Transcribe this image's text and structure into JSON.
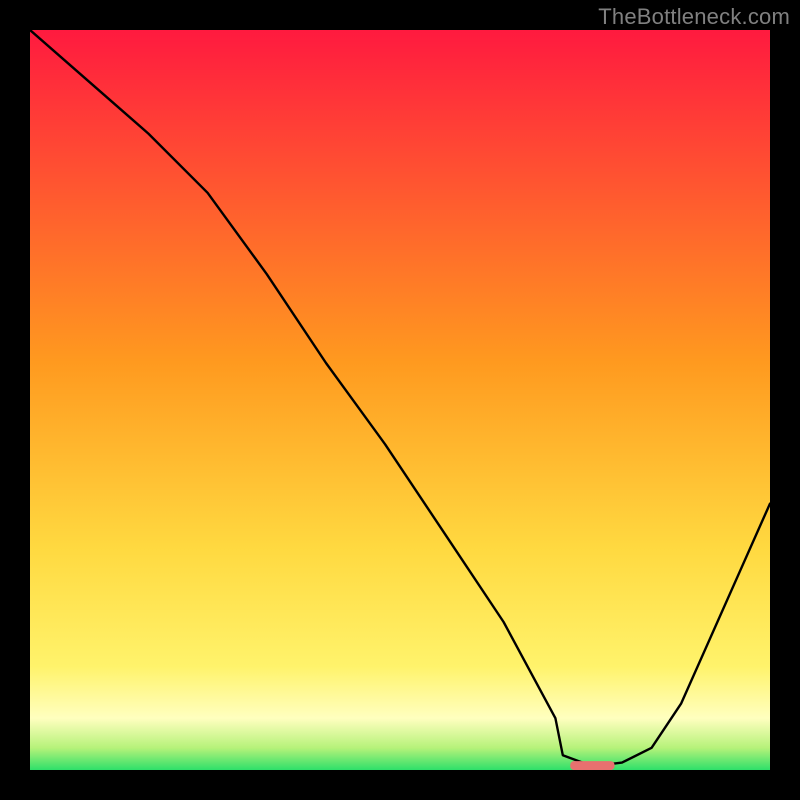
{
  "watermark": "TheBottleneck.com",
  "chart_data": {
    "type": "line",
    "title": "",
    "xlabel": "",
    "ylabel": "",
    "xlim": [
      0,
      100
    ],
    "ylim": [
      0,
      100
    ],
    "gradient_stops": [
      {
        "offset": 0.0,
        "color": "#ff1a3f"
      },
      {
        "offset": 0.45,
        "color": "#ff9a1f"
      },
      {
        "offset": 0.7,
        "color": "#ffd940"
      },
      {
        "offset": 0.86,
        "color": "#fff36b"
      },
      {
        "offset": 0.93,
        "color": "#ffffbf"
      },
      {
        "offset": 0.97,
        "color": "#b6f27a"
      },
      {
        "offset": 1.0,
        "color": "#2ee06a"
      }
    ],
    "series": [
      {
        "name": "bottleneck-curve",
        "x": [
          0,
          8,
          16,
          24,
          32,
          40,
          48,
          56,
          64,
          71,
          72,
          76,
          80,
          84,
          88,
          92,
          96,
          100
        ],
        "y": [
          100,
          93,
          86,
          78,
          67,
          55,
          44,
          32,
          20,
          7,
          2,
          0.5,
          1,
          3,
          9,
          18,
          27,
          36
        ]
      }
    ],
    "marker": {
      "name": "optimum-marker",
      "x_center": 76,
      "y": 0.6,
      "width": 6,
      "color": "#e8706f"
    }
  }
}
